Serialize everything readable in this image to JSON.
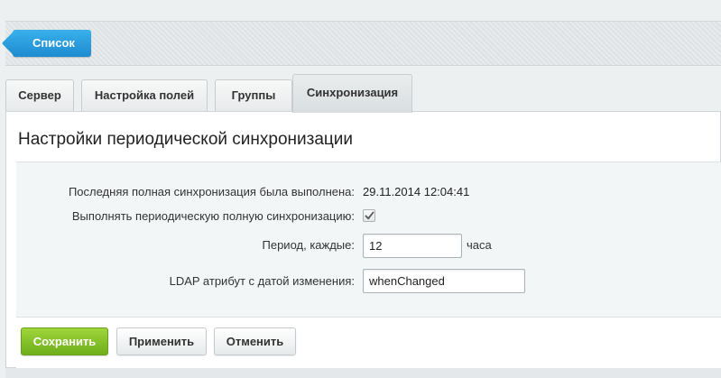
{
  "toolbar": {
    "back_label": "Список"
  },
  "tabs": [
    {
      "label": "Сервер"
    },
    {
      "label": "Настройка полей"
    },
    {
      "label": "Группы"
    },
    {
      "label": "Синхронизация",
      "active": true
    }
  ],
  "section": {
    "title": "Настройки периодической синхронизации"
  },
  "form": {
    "last_sync": {
      "label": "Последняя полная синхронизация была выполнена:",
      "value": "29.11.2014 12:04:41"
    },
    "periodic": {
      "label": "Выполнять периодическую полную синхронизацию:",
      "checked": true,
      "icon": "checkmark-icon"
    },
    "period": {
      "label": "Период, каждые:",
      "value": "12",
      "unit": "часа"
    },
    "ldap_attr": {
      "label": "LDAP атрибут с датой изменения:",
      "value": "whenChanged"
    }
  },
  "buttons": {
    "save": "Сохранить",
    "apply": "Применить",
    "cancel": "Отменить"
  },
  "colors": {
    "back_button": "#2a9de0",
    "save_button": "#86c42a"
  }
}
